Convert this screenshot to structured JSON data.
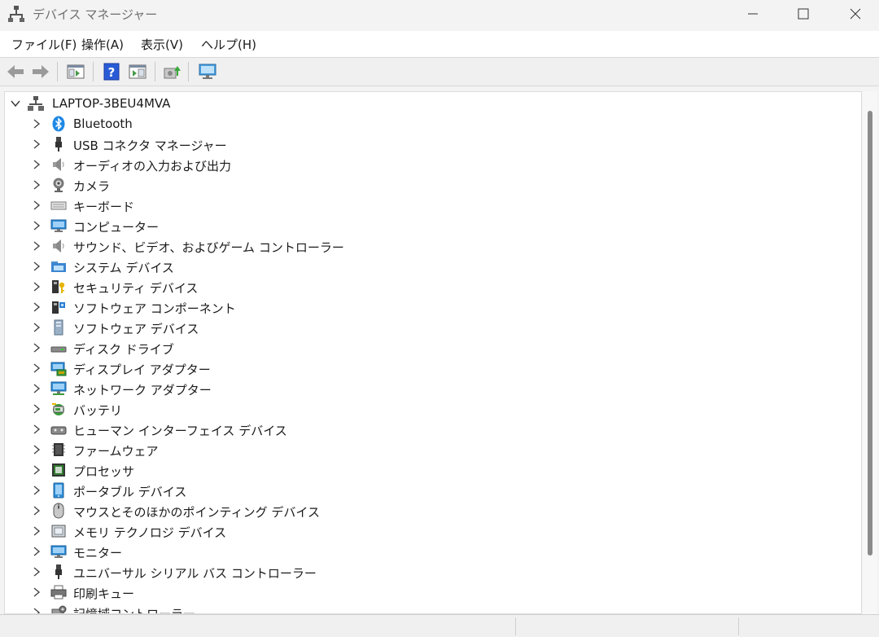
{
  "window": {
    "title": "デバイス マネージャー",
    "minimize_label": "—",
    "maximize_label": "□",
    "close_label": "✕"
  },
  "menu": {
    "items": [
      "ファイル(F)",
      "操作(A)",
      "表示(V)",
      "ヘルプ(H)"
    ]
  },
  "toolbar": {
    "buttons": [
      "back-icon",
      "forward-icon",
      "show-hide-console-tree-icon",
      "help-icon",
      "properties-pane-icon",
      "update-driver-icon",
      "scan-hardware-icon"
    ]
  },
  "tree": {
    "root": "LAPTOP-3BEU4MVA",
    "items": [
      {
        "label": "Bluetooth",
        "icon": "bluetooth-icon"
      },
      {
        "label": "USB コネクタ マネージャー",
        "icon": "usb-connector-icon"
      },
      {
        "label": "オーディオの入力および出力",
        "icon": "speaker-icon"
      },
      {
        "label": "カメラ",
        "icon": "camera-icon"
      },
      {
        "label": "キーボード",
        "icon": "keyboard-icon"
      },
      {
        "label": "コンピューター",
        "icon": "computer-icon"
      },
      {
        "label": "サウンド、ビデオ、およびゲーム コントローラー",
        "icon": "sound-icon"
      },
      {
        "label": "システム デバイス",
        "icon": "system-folder-icon"
      },
      {
        "label": "セキュリティ デバイス",
        "icon": "security-key-icon"
      },
      {
        "label": "ソフトウェア コンポーネント",
        "icon": "software-component-icon"
      },
      {
        "label": "ソフトウェア デバイス",
        "icon": "software-device-icon"
      },
      {
        "label": "ディスク ドライブ",
        "icon": "disk-drive-icon"
      },
      {
        "label": "ディスプレイ アダプター",
        "icon": "display-adapter-icon"
      },
      {
        "label": "ネットワーク アダプター",
        "icon": "network-adapter-icon"
      },
      {
        "label": "バッテリ",
        "icon": "battery-icon"
      },
      {
        "label": "ヒューマン インターフェイス デバイス",
        "icon": "hid-icon"
      },
      {
        "label": "ファームウェア",
        "icon": "firmware-icon"
      },
      {
        "label": "プロセッサ",
        "icon": "processor-icon"
      },
      {
        "label": "ポータブル デバイス",
        "icon": "portable-device-icon"
      },
      {
        "label": "マウスとそのほかのポインティング デバイス",
        "icon": "mouse-icon"
      },
      {
        "label": "メモリ テクノロジ デバイス",
        "icon": "memory-icon"
      },
      {
        "label": "モニター",
        "icon": "monitor-icon"
      },
      {
        "label": "ユニバーサル シリアル バス コントローラー",
        "icon": "usb-controller-icon"
      },
      {
        "label": "印刷キュー",
        "icon": "printer-icon"
      },
      {
        "label": "記憶域コントローラー",
        "icon": "storage-controller-icon"
      }
    ]
  },
  "colors": {
    "accent_blue": "#1e88e5",
    "titlebar_bg": "#f3f3f3",
    "tree_bg": "#ffffff",
    "scroll_thumb": "#8a8a8a"
  }
}
